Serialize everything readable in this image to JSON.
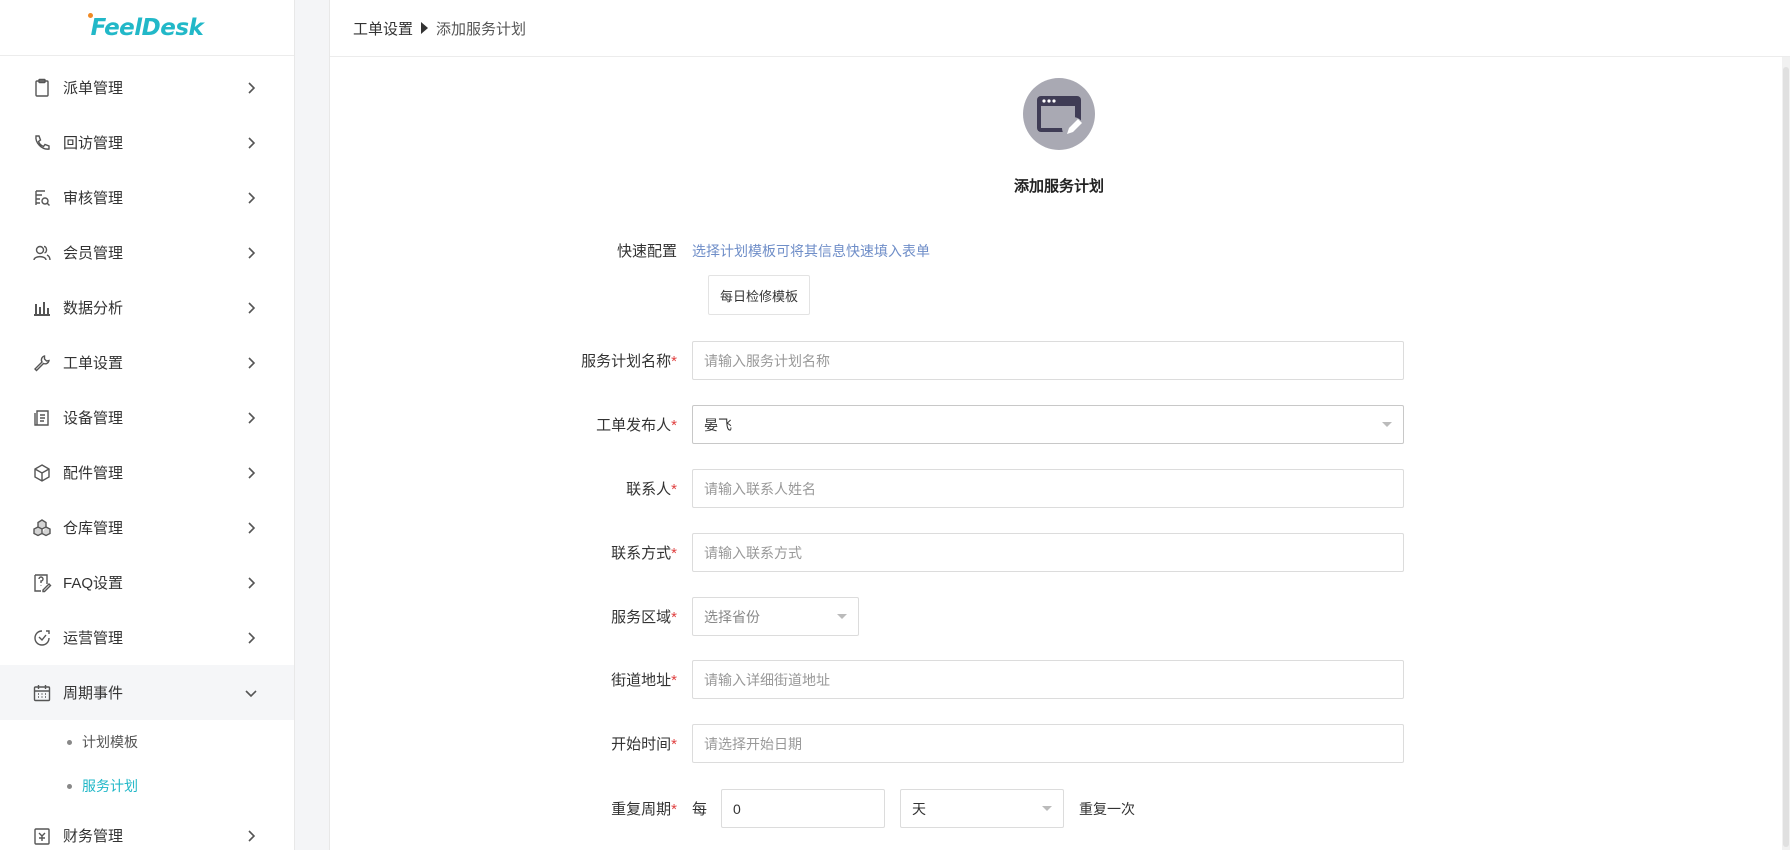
{
  "app": {
    "logo": "FeelDesk"
  },
  "sidebar": {
    "items": [
      {
        "label": "派单管理",
        "icon": "clipboard-icon"
      },
      {
        "label": "回访管理",
        "icon": "phone-icon"
      },
      {
        "label": "审核管理",
        "icon": "audit-icon"
      },
      {
        "label": "会员管理",
        "icon": "users-icon"
      },
      {
        "label": "数据分析",
        "icon": "bar-chart-icon"
      },
      {
        "label": "工单设置",
        "icon": "wrench-icon"
      },
      {
        "label": "设备管理",
        "icon": "device-icon"
      },
      {
        "label": "配件管理",
        "icon": "box-icon"
      },
      {
        "label": "仓库管理",
        "icon": "warehouse-icon"
      },
      {
        "label": "FAQ设置",
        "icon": "faq-icon"
      },
      {
        "label": "运营管理",
        "icon": "operations-icon"
      },
      {
        "label": "周期事件",
        "icon": "calendar-icon"
      }
    ],
    "submenu": [
      {
        "label": "计划模板"
      },
      {
        "label": "服务计划"
      }
    ],
    "last_item": {
      "label": "财务管理",
      "icon": "finance-icon"
    }
  },
  "breadcrumb": {
    "root": "工单设置",
    "current": "添加服务计划"
  },
  "form": {
    "title": "添加服务计划",
    "quick_config": {
      "label": "快速配置",
      "hint": "选择计划模板可将其信息快速填入表单",
      "template_button": "每日检修模板"
    },
    "plan_name": {
      "label": "服务计划名称",
      "placeholder": "请输入服务计划名称"
    },
    "publisher": {
      "label": "工单发布人",
      "value": "晏飞"
    },
    "contact": {
      "label": "联系人",
      "placeholder": "请输入联系人姓名"
    },
    "contact_method": {
      "label": "联系方式",
      "placeholder": "请输入联系方式"
    },
    "service_area": {
      "label": "服务区域",
      "placeholder": "选择省份"
    },
    "street_address": {
      "label": "街道地址",
      "placeholder": "请输入详细街道地址"
    },
    "start_time": {
      "label": "开始时间",
      "placeholder": "请选择开始日期"
    },
    "repeat_cycle": {
      "label": "重复周期",
      "every": "每",
      "value": "0",
      "unit": "天",
      "suffix": "重复一次"
    },
    "required_mark": "*"
  },
  "colors": {
    "accent": "#22b8c8",
    "hint": "#6f8ec8",
    "required": "#e04040"
  }
}
